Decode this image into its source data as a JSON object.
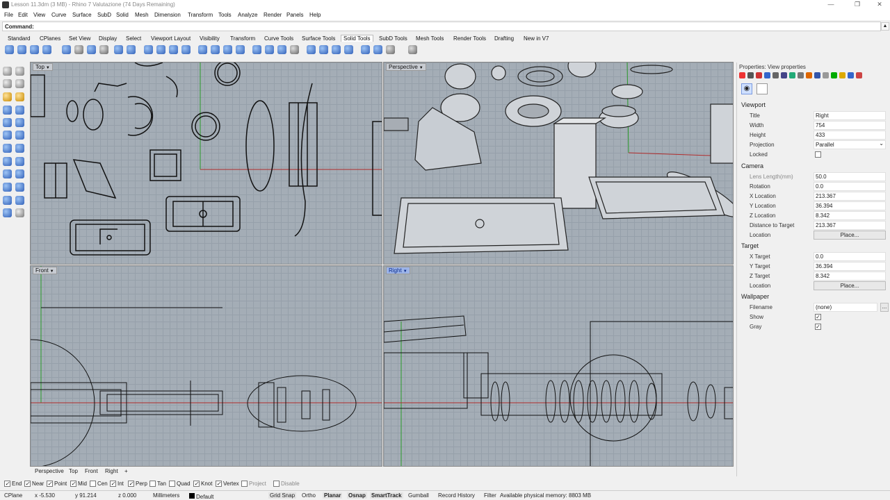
{
  "window": {
    "title": "Lesson 11.3dm (3 MB) - Rhino 7 Valutazione (74 Days Remaining)",
    "minimize": "—",
    "restore": "❐",
    "close": "✕"
  },
  "menu": [
    "File",
    "Edit",
    "View",
    "Curve",
    "Surface",
    "SubD",
    "Solid",
    "Mesh",
    "Dimension",
    "Transform",
    "Tools",
    "Analyze",
    "Render",
    "Panels",
    "Help"
  ],
  "command": {
    "label": "Command:"
  },
  "toolbar_tabs": [
    "Standard",
    "CPlanes",
    "Set View",
    "Display",
    "Select",
    "Viewport Layout",
    "Visibility",
    "Transform",
    "Curve Tools",
    "Surface Tools",
    "Solid Tools",
    "SubD Tools",
    "Mesh Tools",
    "Render Tools",
    "Drafting",
    "New in V7"
  ],
  "active_tab": "Solid Tools",
  "viewports": {
    "top": "Top",
    "perspective": "Perspective",
    "front": "Front",
    "right": "Right"
  },
  "viewport_tabs": [
    "Perspective",
    "Top",
    "Front",
    "Right",
    "+"
  ],
  "properties": {
    "header": "Properties: View properties",
    "viewport_section": "Viewport",
    "title_label": "Title",
    "title_value": "Right",
    "width_label": "Width",
    "width_value": "754",
    "height_label": "Height",
    "height_value": "433",
    "projection_label": "Projection",
    "projection_value": "Parallel",
    "locked_label": "Locked",
    "camera_section": "Camera",
    "lens_label": "Lens Length(mm)",
    "lens_value": "50.0",
    "rotation_label": "Rotation",
    "rotation_value": "0.0",
    "xloc_label": "X Location",
    "xloc_value": "213.367",
    "yloc_label": "Y Location",
    "yloc_value": "36.394",
    "zloc_label": "Z Location",
    "zloc_value": "8.342",
    "dist_label": "Distance to Target",
    "dist_value": "213.367",
    "location_label": "Location",
    "place_button": "Place...",
    "target_section": "Target",
    "xt_label": "X Target",
    "xt_value": "0.0",
    "yt_label": "Y Target",
    "yt_value": "36.394",
    "zt_label": "Z Target",
    "zt_value": "8.342",
    "tlocation_label": "Location",
    "wallpaper_section": "Wallpaper",
    "filename_label": "Filename",
    "filename_value": "(none)",
    "browse_button": "...",
    "show_label": "Show",
    "gray_label": "Gray"
  },
  "osnaps": [
    {
      "label": "End",
      "on": true
    },
    {
      "label": "Near",
      "on": true
    },
    {
      "label": "Point",
      "on": true
    },
    {
      "label": "Mid",
      "on": true
    },
    {
      "label": "Cen",
      "on": false
    },
    {
      "label": "Int",
      "on": true
    },
    {
      "label": "Perp",
      "on": true
    },
    {
      "label": "Tan",
      "on": false
    },
    {
      "label": "Quad",
      "on": false
    },
    {
      "label": "Knot",
      "on": true
    },
    {
      "label": "Vertex",
      "on": true
    },
    {
      "label": "Project",
      "on": false
    },
    {
      "label": "Disable",
      "on": false
    }
  ],
  "status": {
    "cplane": "CPlane",
    "x": "x -5.530",
    "y": "y 91.214",
    "z": "z 0.000",
    "units": "Millimeters",
    "layer": "Default",
    "grid_snap": "Grid Snap",
    "ortho": "Ortho",
    "planar": "Planar",
    "osnap": "Osnap",
    "smarttrack": "SmartTrack",
    "gumball": "Gumball",
    "record_history": "Record History",
    "filter": "Filter",
    "memory": "Available physical memory: 8803 MB"
  }
}
